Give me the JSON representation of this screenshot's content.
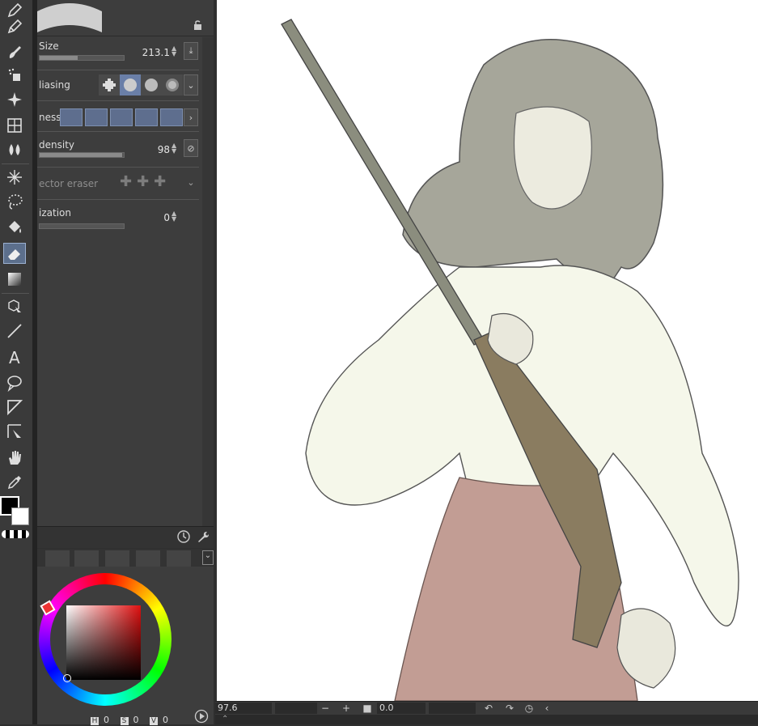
{
  "tool_property": {
    "brush_size": {
      "label": "Size",
      "value": "213.1",
      "fill": 0.45
    },
    "anti_aliasing": {
      "label": "liasing"
    },
    "hardness": {
      "label": "ness"
    },
    "brush_density": {
      "label": "density",
      "value": "98",
      "fill": 0.98
    },
    "vector_eraser": {
      "label": "ector eraser"
    },
    "stabilization": {
      "label": "ization",
      "value": "0",
      "fill": 0.0
    }
  },
  "color": {
    "foreground": "#000000",
    "background": "#ffffff",
    "hsv": {
      "h_label": "H",
      "h": "0",
      "s_label": "S",
      "s": "0",
      "v_label": "V",
      "v": "0"
    }
  },
  "status": {
    "zoom": "97.6",
    "rotation": "0.0"
  },
  "icons": [
    "pen-icon",
    "pencil-icon",
    "brush-icon",
    "airbrush-icon",
    "decoration-icon",
    "frame-icon",
    "blend-icon",
    "auto-select-icon",
    "lasso-icon",
    "fill-icon",
    "eraser-icon",
    "gradient-icon",
    "operation-icon",
    "line-icon",
    "text-icon",
    "balloon-icon",
    "ruler-icon",
    "correct-line-icon",
    "hand-icon",
    "eyedropper-icon"
  ]
}
